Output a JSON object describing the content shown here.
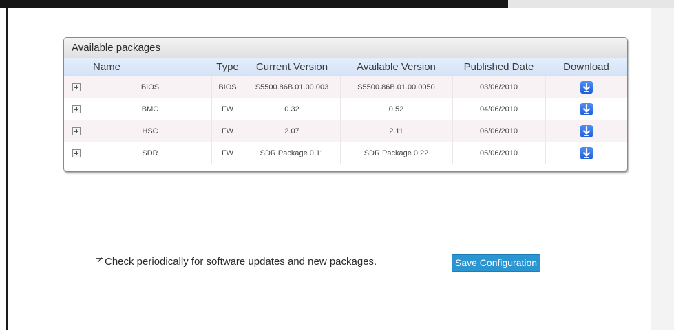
{
  "panel": {
    "title": "Available packages"
  },
  "table": {
    "headers": [
      "Name",
      "Type",
      "Current Version",
      "Available Version",
      "Published Date",
      "Download"
    ],
    "rows": [
      {
        "name": "BIOS",
        "type": "BIOS",
        "current_version": "S5500.86B.01.00.003",
        "available_version": "S5500.86B.01.00.0050",
        "published_date": "03/06/2010"
      },
      {
        "name": "BMC",
        "type": "FW",
        "current_version": "0.32",
        "available_version": "0.52",
        "published_date": "04/06/2010"
      },
      {
        "name": "HSC",
        "type": "FW",
        "current_version": "2.07",
        "available_version": "2.11",
        "published_date": "06/06/2010"
      },
      {
        "name": "SDR",
        "type": "FW",
        "current_version": "SDR Package 0.11",
        "available_version": "SDR Package 0.22",
        "published_date": "05/06/2010"
      }
    ],
    "expand_icon": "plus-box-icon",
    "download_icon": "download-arrow-icon"
  },
  "options": {
    "check_updates_label": "Check periodically for software updates and new packages.",
    "check_updates_checked": true
  },
  "actions": {
    "save_label": "Save Configuration"
  },
  "colors": {
    "save_button": "#2b95d2",
    "header_row": "#d3e2f6",
    "download_icon": "#1f5fd6"
  }
}
